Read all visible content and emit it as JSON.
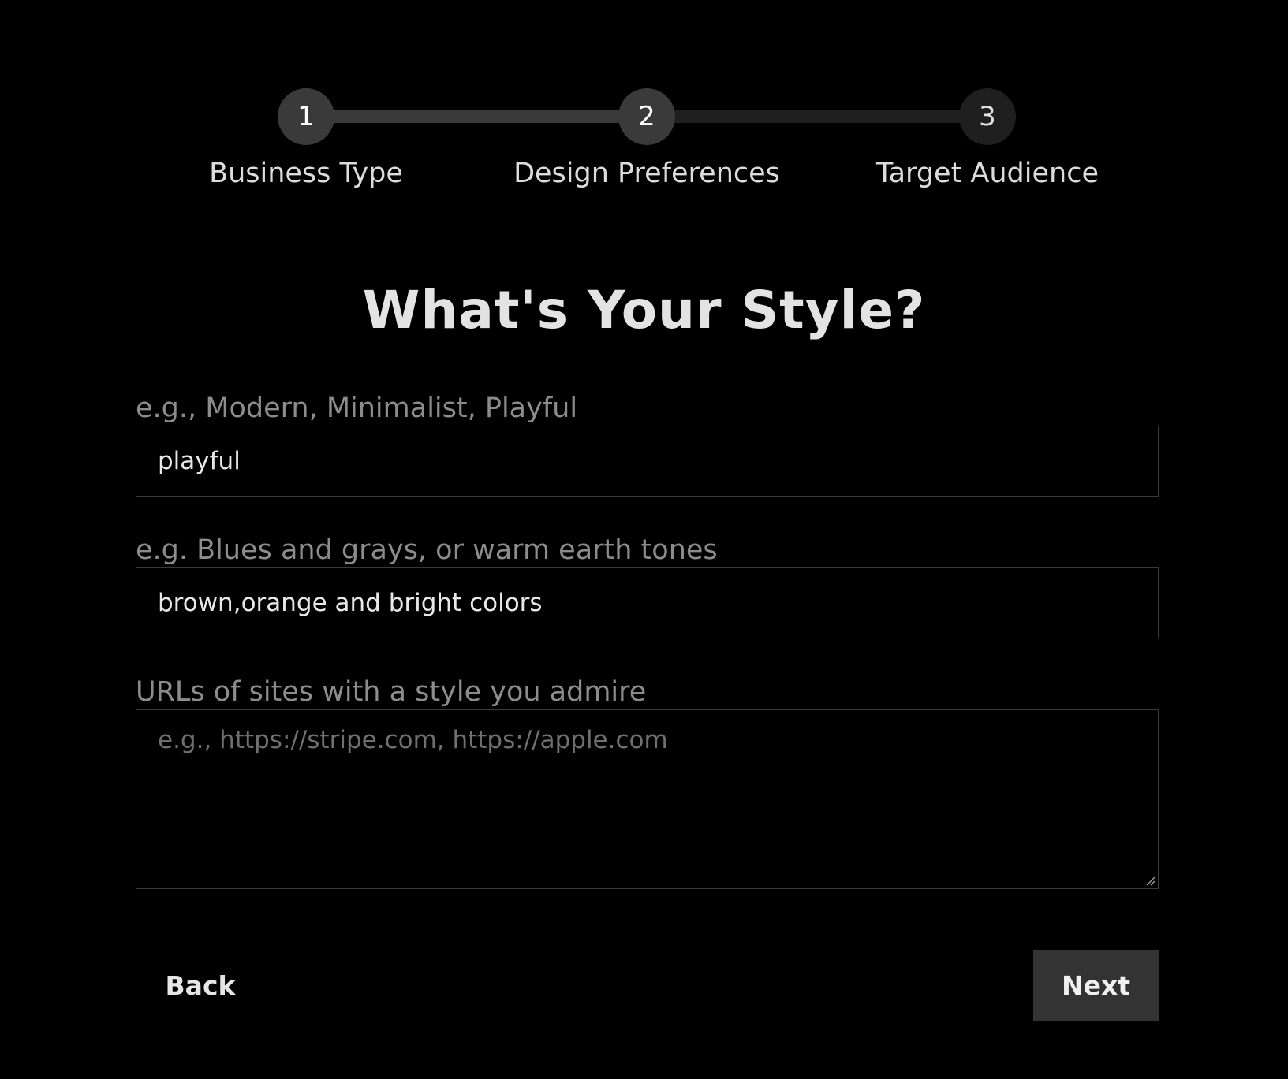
{
  "stepper": {
    "steps": [
      {
        "number": "1",
        "label": "Business Type",
        "state": "completed"
      },
      {
        "number": "2",
        "label": "Design Preferences",
        "state": "active"
      },
      {
        "number": "3",
        "label": "Target Audience",
        "state": "upcoming"
      }
    ]
  },
  "page": {
    "title": "What's Your Style?"
  },
  "form": {
    "style_field": {
      "label": "e.g., Modern, Minimalist, Playful",
      "value": "playful"
    },
    "colors_field": {
      "label": "e.g. Blues and grays, or warm earth tones",
      "value": "brown,orange and bright colors"
    },
    "urls_field": {
      "label": "URLs of sites with a style you admire",
      "value": "",
      "placeholder": "e.g., https://stripe.com, https://apple.com"
    }
  },
  "actions": {
    "back_label": "Back",
    "next_label": "Next"
  },
  "colors": {
    "background": "#000000",
    "step_filled": "#3a3a3a",
    "step_upcoming": "#1f1f1f",
    "button_primary": "#333333"
  }
}
